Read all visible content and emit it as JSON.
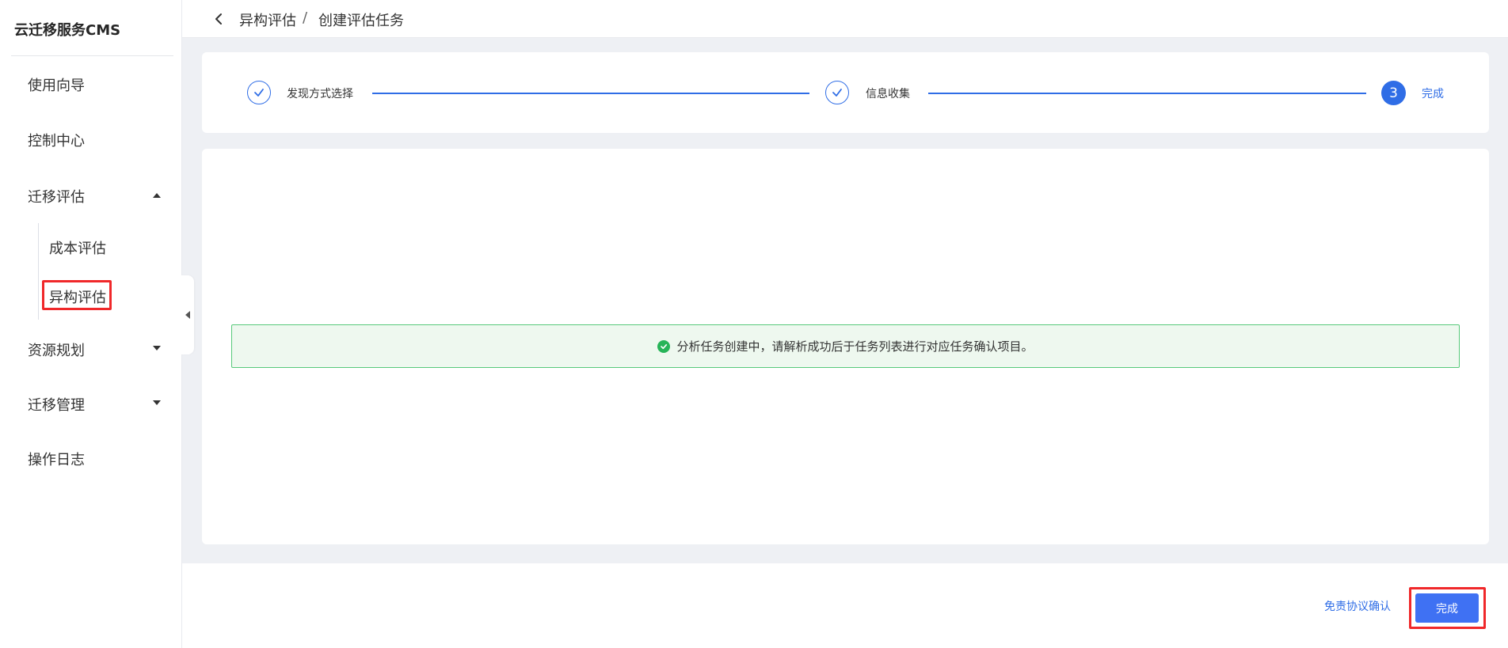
{
  "app": {
    "brand": "云迁移服务CMS"
  },
  "sidebar": {
    "items": [
      {
        "label": "使用向导"
      },
      {
        "label": "控制中心"
      },
      {
        "label": "迁移评估"
      },
      {
        "label": "资源规划"
      },
      {
        "label": "迁移管理"
      },
      {
        "label": "操作日志"
      }
    ],
    "sub_items": [
      {
        "label": "成本评估"
      },
      {
        "label": "异构评估"
      }
    ]
  },
  "breadcrumb": {
    "parent": "异构评估",
    "separator": "/",
    "current": "创建评估任务"
  },
  "steps": [
    {
      "label": "发现方式选择",
      "status": "done"
    },
    {
      "label": "信息收集",
      "status": "done"
    },
    {
      "label": "完成",
      "number": "3",
      "status": "active"
    }
  ],
  "notice": {
    "text": "分析任务创建中，请解析成功后于任务列表进行对应任务确认项目。",
    "type": "success"
  },
  "footer": {
    "disclaimer_link": "免责协议确认",
    "finish_button": "完成"
  },
  "colors": {
    "primary": "#2f6de6",
    "button": "#3f71f3",
    "success": "#27b458",
    "highlight": "#f0282a"
  }
}
